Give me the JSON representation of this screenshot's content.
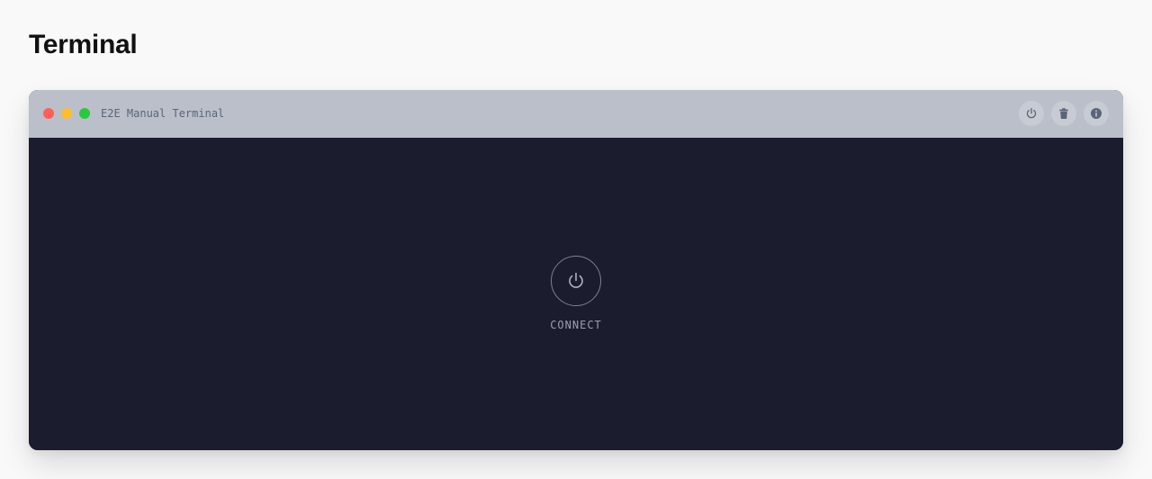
{
  "page": {
    "title": "Terminal"
  },
  "terminal": {
    "window_title": "E2E Manual Terminal",
    "traffic_lights": {
      "close_color": "#ff5f57",
      "minimize_color": "#febc2e",
      "maximize_color": "#28c840"
    },
    "toolbar": {
      "buttons": [
        {
          "icon": "power-icon"
        },
        {
          "icon": "trash-icon"
        },
        {
          "icon": "info-icon"
        }
      ]
    },
    "body": {
      "connect_icon": "power-icon",
      "connect_label": "CONNECT"
    }
  },
  "colors": {
    "page_background": "#f9f9fa",
    "titlebar_background": "#bbbfca",
    "terminal_background": "#1b1c2e",
    "icon_color": "#5b6577",
    "connect_accent": "#9aa0b0"
  }
}
